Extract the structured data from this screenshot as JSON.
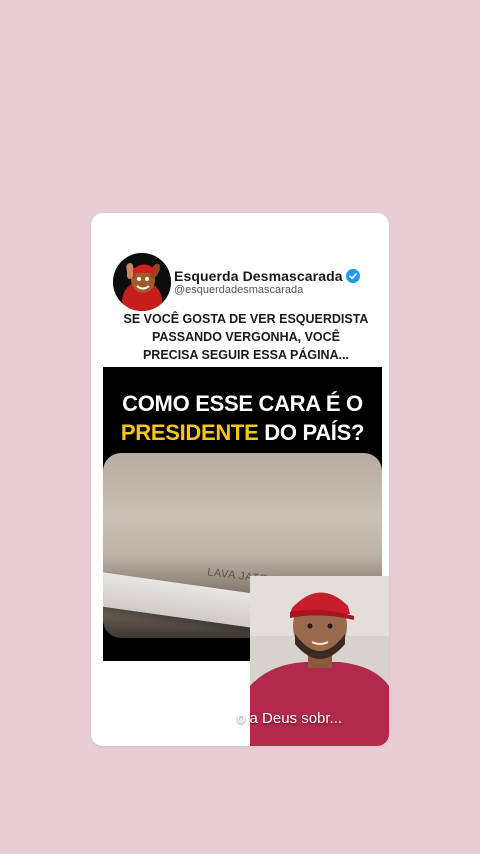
{
  "post": {
    "author_name": "Esquerda Desmascarada",
    "author_handle": "@esquerdadesmascarada",
    "caption": "SE VOCÊ GOSTA DE VER ESQUERDISTA\nPASSANDO VERGONHA, VOCÊ\nPRECISA SEGUIR ESSA PÁGINA..."
  },
  "video": {
    "headline_line1": "COMO ESSE CARA É O",
    "headline_line2_highlight": "PRESIDENTE",
    "headline_line2_rest": " DO PAÍS?",
    "plate_text": "LAVA JATO 25",
    "subtitle": "o a Deus sobr..."
  },
  "colors": {
    "background": "#e8cdd4",
    "highlight": "#f5c518",
    "verified": "#1d9bf0"
  },
  "icons": {
    "verified": "verified-badge-icon"
  }
}
